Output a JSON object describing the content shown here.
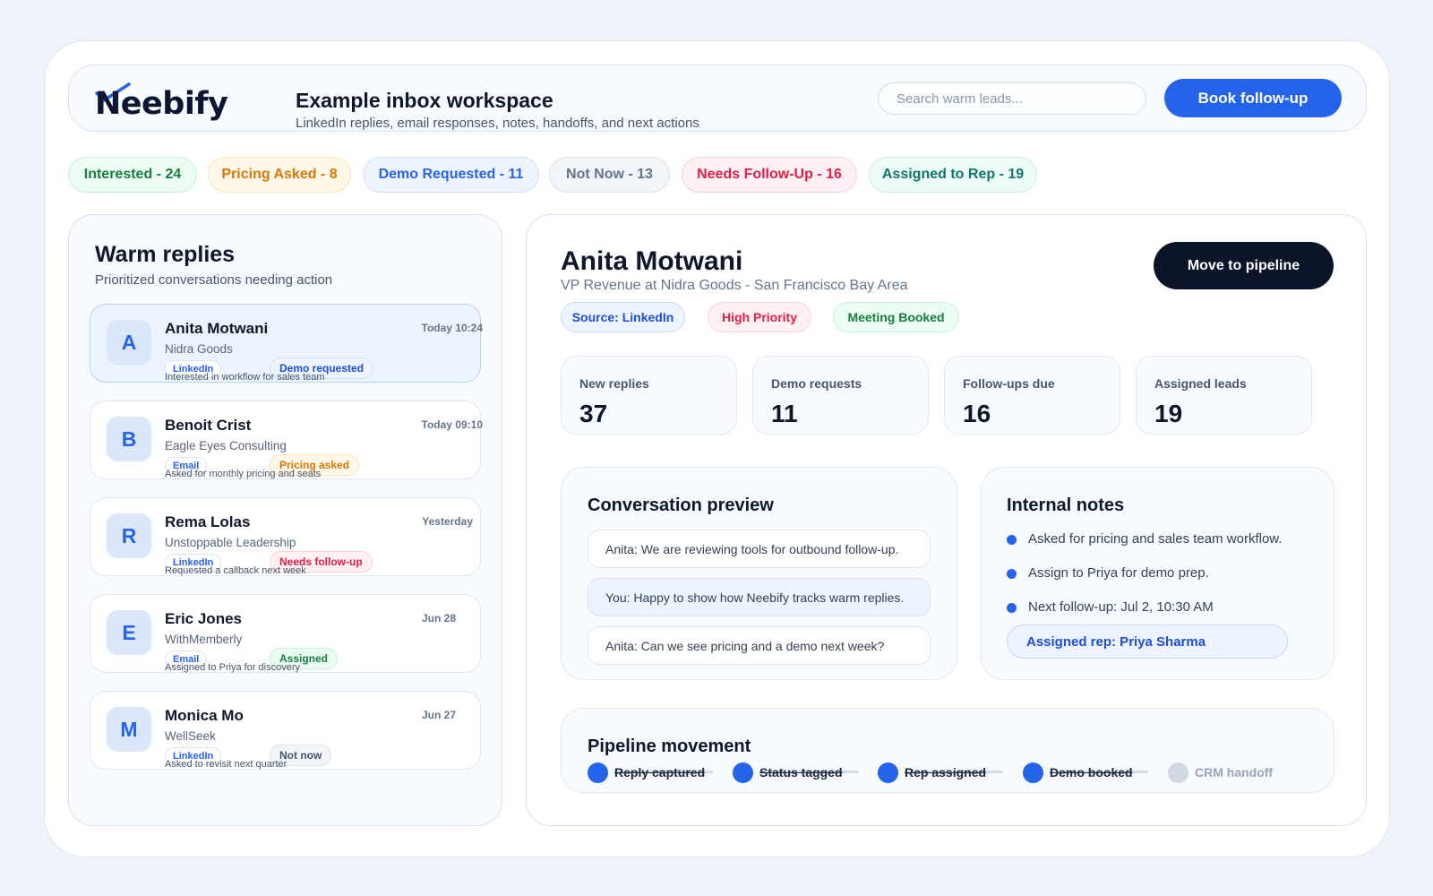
{
  "app": {
    "logo": "Neebify"
  },
  "header": {
    "title": "Example inbox workspace",
    "subtitle": "LinkedIn replies, email responses, notes, handoffs, and next actions",
    "search_placeholder": "Search warm leads...",
    "book_label": "Book follow-up"
  },
  "filters": [
    {
      "label": "Interested - 24"
    },
    {
      "label": "Pricing Asked - 8"
    },
    {
      "label": "Demo Requested - 11"
    },
    {
      "label": "Not Now - 13"
    },
    {
      "label": "Needs Follow-Up - 16"
    },
    {
      "label": "Assigned to Rep - 19"
    }
  ],
  "inbox": {
    "title": "Warm replies",
    "subtitle": "Prioritized conversations needing action",
    "items": [
      {
        "initial": "A",
        "name": "Anita Motwani",
        "company": "Nidra Goods",
        "time": "Today 10:24",
        "source": "LinkedIn",
        "status": "Demo requested",
        "note": "Interested in workflow for sales team"
      },
      {
        "initial": "B",
        "name": "Benoit Crist",
        "company": "Eagle Eyes Consulting",
        "time": "Today 09:10",
        "source": "Email",
        "status": "Pricing asked",
        "note": "Asked for monthly pricing and seats"
      },
      {
        "initial": "R",
        "name": "Rema Lolas",
        "company": "Unstoppable Leadership",
        "time": "Yesterday",
        "source": "LinkedIn",
        "status": "Needs follow-up",
        "note": "Requested a callback next week"
      },
      {
        "initial": "E",
        "name": "Eric Jones",
        "company": "WithMemberly",
        "time": "Jun 28",
        "source": "Email",
        "status": "Assigned",
        "note": "Assigned to Priya for discovery"
      },
      {
        "initial": "M",
        "name": "Monica Mo",
        "company": "WellSeek",
        "time": "Jun 27",
        "source": "LinkedIn",
        "status": "Not now",
        "note": "Asked to revisit next quarter"
      }
    ]
  },
  "lead": {
    "name": "Anita Motwani",
    "role": "VP Revenue at Nidra Goods - San Francisco Bay Area",
    "move_label": "Move to pipeline",
    "pills": [
      {
        "label": "Source: LinkedIn"
      },
      {
        "label": "High Priority"
      },
      {
        "label": "Meeting Booked"
      }
    ]
  },
  "stats": [
    {
      "label": "New replies",
      "value": "37"
    },
    {
      "label": "Demo requests",
      "value": "11"
    },
    {
      "label": "Follow-ups due",
      "value": "16"
    },
    {
      "label": "Assigned leads",
      "value": "19"
    }
  ],
  "conversation": {
    "title": "Conversation preview",
    "messages": [
      {
        "text": "Anita: We are reviewing tools for outbound follow-up."
      },
      {
        "text": "You: Happy to show how Neebify tracks warm replies."
      },
      {
        "text": "Anita: Can we see pricing and a demo next week?"
      }
    ]
  },
  "notes": {
    "title": "Internal notes",
    "items": [
      {
        "text": "Asked for pricing and sales team workflow."
      },
      {
        "text": "Assign to Priya for demo prep."
      },
      {
        "text": "Next follow-up: Jul 2, 10:30 AM"
      }
    ],
    "assigned": "Assigned rep: Priya Sharma"
  },
  "pipeline": {
    "title": "Pipeline movement",
    "steps": [
      {
        "label": "Reply captured",
        "done": true
      },
      {
        "label": "Status tagged",
        "done": true
      },
      {
        "label": "Rep assigned",
        "done": true
      },
      {
        "label": "Demo booked",
        "done": true
      },
      {
        "label": "CRM handoff",
        "done": false
      }
    ]
  },
  "colors": {
    "accent": "#2563eb",
    "dark": "#0b1527",
    "background": "#eef3fa"
  }
}
